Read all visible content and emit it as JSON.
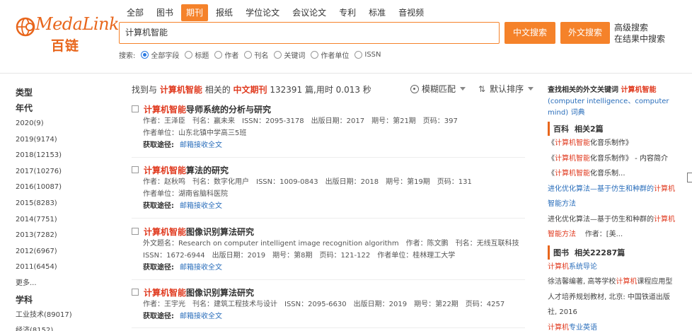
{
  "logo": {
    "text": "MedaLink",
    "cn": "百链"
  },
  "categories": [
    {
      "label": "全部",
      "active": false
    },
    {
      "label": "图书",
      "active": false
    },
    {
      "label": "期刊",
      "active": true
    },
    {
      "label": "报纸",
      "active": false
    },
    {
      "label": "学位论文",
      "active": false
    },
    {
      "label": "会议论文",
      "active": false
    },
    {
      "label": "专利",
      "active": false
    },
    {
      "label": "标准",
      "active": false
    },
    {
      "label": "音视频",
      "active": false
    }
  ],
  "search": {
    "value": "计算机智能",
    "btn_cn": "中文搜索",
    "btn_en": "外文搜索",
    "advanced": "高级搜索",
    "within": "在结果中搜索"
  },
  "fields": {
    "label": "搜索:",
    "options": [
      {
        "label": "全部字段",
        "checked": true
      },
      {
        "label": "标题",
        "checked": false
      },
      {
        "label": "作者",
        "checked": false
      },
      {
        "label": "刊名",
        "checked": false
      },
      {
        "label": "关键词",
        "checked": false
      },
      {
        "label": "作者单位",
        "checked": false
      },
      {
        "label": "ISSN",
        "checked": false
      }
    ]
  },
  "sidebar": {
    "type_title": "类型",
    "year_title": "年代",
    "years": [
      "2020(9)",
      "2019(9174)",
      "2018(12153)",
      "2017(10276)",
      "2016(10087)",
      "2015(8283)",
      "2014(7751)",
      "2013(7282)",
      "2012(6967)",
      "2011(6454)"
    ],
    "more": "更多...",
    "subject_title": "学科",
    "subjects": [
      "工业技术(89017)",
      "经济(8152)"
    ]
  },
  "summary": {
    "prefix": "找到与",
    "keyword": "计算机智能",
    "mid": "相关的",
    "type": "中文期刊",
    "rest": "132391 篇,用时 0.013 秒"
  },
  "fuzzy": "模糊匹配",
  "sort": "默认排序",
  "results": [
    {
      "hl": "计算机智能",
      "title": "导师系统的分析与研究",
      "lines": [
        "作者：王泽臣　刊名：赢未来　ISSN：2095-3178　出版日期：2017　期号：第21期　页码：397",
        "作者单位：山东北镇中学高三5班"
      ],
      "get_label": "获取途径:",
      "get_link": "邮箱接收全文"
    },
    {
      "hl": "计算机智能",
      "title": "算法的研究",
      "lines": [
        "作者：赵秋鸣　刊名：数字化用户　ISSN：1009-0843　出版日期：2018　期号：第19期　页码：131",
        "作者单位：湖南省脑科医院"
      ],
      "get_label": "获取途径:",
      "get_link": "邮箱接收全文"
    },
    {
      "hl": "计算机智能",
      "title": "图像识别算法研究",
      "lines": [
        "外文题名：Research on computer intelligent image recognition algorithm　作者：陈文鹏　刊名：无线互联科技",
        "ISSN：1672-6944　出版日期：2019　期号：第8期　页码：121-122　作者单位：桂林理工大学"
      ],
      "get_label": "获取途径:",
      "get_link": "邮箱接收全文"
    },
    {
      "hl": "计算机智能",
      "title": "图像识别算法研究",
      "lines": [
        "作者：王宇光　刊名：建筑工程技术与设计　ISSN：2095-6630　出版日期：2019　期号：第22期　页码：4257"
      ],
      "get_label": "获取途径:",
      "get_link": "邮箱接收全文"
    }
  ],
  "right": {
    "kw_prefix": "查找相关的外文关键词",
    "kw_hl": "计算机智能",
    "kw_terms": "(computer intelligence、computer mind)",
    "kw_dict": "词典",
    "baike_title": "百科",
    "baike_count": "相关2篇",
    "baike_items": [
      {
        "pre": "《",
        "hl": "计算机智能",
        "post": "化音乐制作》"
      },
      {
        "pre": "《",
        "hl": "计算机智能",
        "post": "化音乐制作》 - 内容简介"
      },
      {
        "pre": "《",
        "hl": "计算机智能",
        "post": "化音乐制..."
      }
    ],
    "baike_extra_link_a": "进化优化算法—基于仿生和种群的",
    "baike_extra_link_hl": "计算机",
    "baike_extra_link_b": "智能方法",
    "baike_extra_text_a": "进化优化算法—基于仿生和种群的",
    "baike_extra_text_hl": "计算机",
    "baike_extra_text_b": "智能方法",
    "baike_extra_text_c": "作者：[美...",
    "book_title": "图书",
    "book_count": "相关22287篇",
    "book_link_hl": "计算机",
    "book_link_post": "系统导论",
    "book_desc_a": "徐洁馨编著, 高等学校",
    "book_desc_hl": "计算机",
    "book_desc_b": "课程应用型人才培养规划教材, 北京: 中国铁道出版社, 2016",
    "book_link2_hl": "计算机",
    "book_link2_post": "专业英语"
  }
}
